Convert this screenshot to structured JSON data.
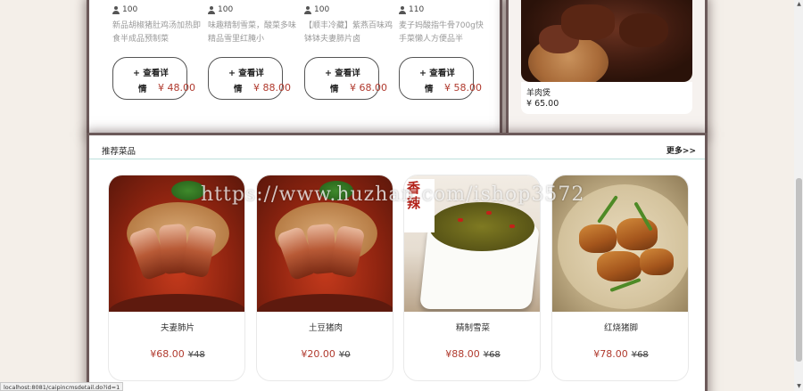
{
  "top_products": [
    {
      "count": "100",
      "desc": "新品胡椒猪肚鸡汤加热即食半成品预制菜",
      "btn_line1": "+ 查看详",
      "btn_line2": "情",
      "price": "¥ 48.00"
    },
    {
      "count": "100",
      "desc": "味趣精制雪菜，酸菜多味精品雪里红腌小",
      "btn_line1": "+ 查看详",
      "btn_line2": "情",
      "price": "¥ 88.00"
    },
    {
      "count": "100",
      "desc": "【顺丰冷藏】紫燕百味鸡钵钵夫妻肺片卤",
      "btn_line1": "+ 查看详",
      "btn_line2": "情",
      "price": "¥ 68.00"
    },
    {
      "count": "110",
      "desc": "麦子妈酸指牛骨700g快手菜懒人方便品半",
      "btn_line1": "+ 查看详",
      "btn_line2": "情",
      "price": "¥ 58.00"
    }
  ],
  "side_item": {
    "name": "羊肉煲",
    "price": "¥ 65.00"
  },
  "recommended": {
    "title": "推荐菜品",
    "more": "更多>>",
    "items": [
      {
        "name": "夫妻肺片",
        "price": "¥68.00",
        "old_price": "¥48"
      },
      {
        "name": "土豆猪肉",
        "price": "¥20.00",
        "old_price": "¥0"
      },
      {
        "name": "精制雪菜",
        "price": "¥88.00",
        "old_price": "¥68"
      },
      {
        "name": "红烧猪脚",
        "price": "¥78.00",
        "old_price": "¥68"
      }
    ]
  },
  "veg_banner": "香辣",
  "watermark": "https://www.huzhan.com/ishop3572",
  "status_url": "localhost:8081/caipincmsdetail.do?id=1",
  "icons": {
    "count": "user-icon",
    "scroll_up": "arrow-up-icon",
    "scroll_down": "arrow-down-icon"
  }
}
